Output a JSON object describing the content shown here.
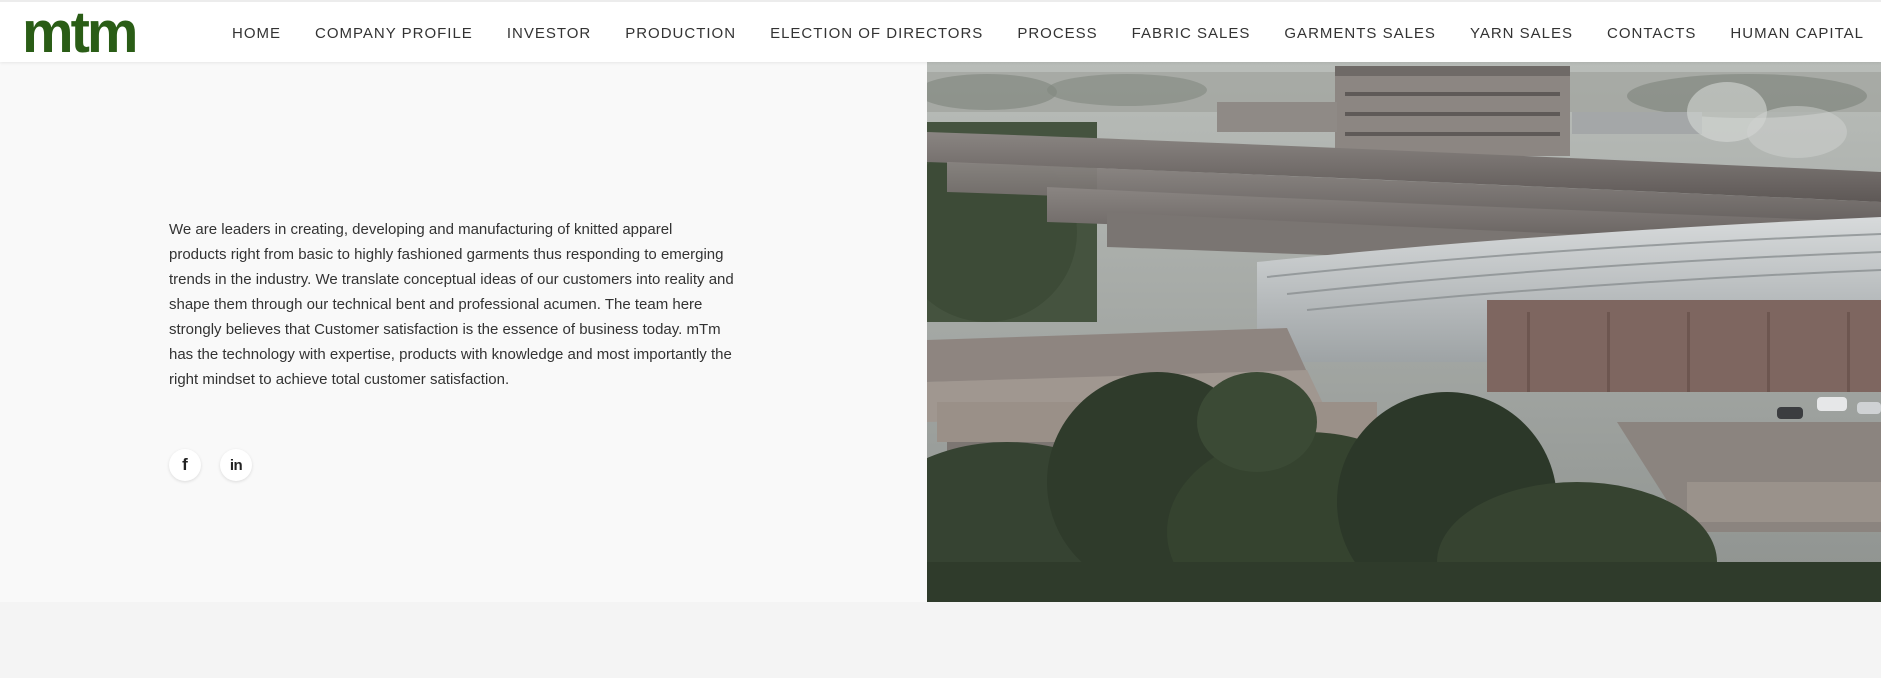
{
  "header": {
    "logo_text": "mtm",
    "nav": [
      {
        "label": "HOME"
      },
      {
        "label": "COMPANY PROFILE"
      },
      {
        "label": "INVESTOR"
      },
      {
        "label": "PRODUCTION"
      },
      {
        "label": "ELECTION OF DIRECTORS"
      },
      {
        "label": "PROCESS"
      },
      {
        "label": "FABRIC SALES"
      },
      {
        "label": "GARMENTS SALES"
      },
      {
        "label": "YARN SALES"
      },
      {
        "label": "CONTACTS"
      },
      {
        "label": "HUMAN CAPITAL"
      }
    ]
  },
  "main": {
    "description": "We are leaders in creating, developing and manufacturing of knitted apparel products right from basic to highly fashioned garments thus responding to emerging trends in the industry. We translate conceptual ideas of our customers into reality and shape them through our technical bent and professional acumen. The team here strongly believes that Customer satisfaction is the essence of business today. mTm has the technology with expertise, products with knowledge and most importantly the right mindset to achieve total customer satisfaction.",
    "social": {
      "facebook_glyph": "f",
      "linkedin_glyph": "in"
    }
  },
  "colors": {
    "brand_green": "#2a5d16",
    "nav_text": "#333333",
    "panel_bg": "#f9f9f9"
  },
  "icons": {
    "facebook": "facebook-icon",
    "linkedin": "linkedin-icon"
  }
}
